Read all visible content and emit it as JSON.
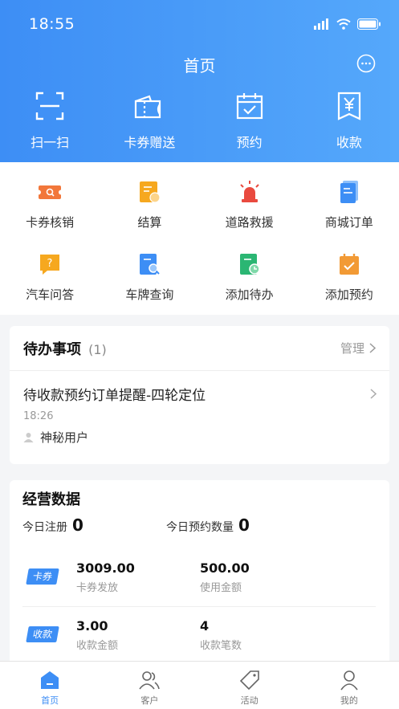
{
  "status_bar": {
    "time": "18:55"
  },
  "header": {
    "title": "首页",
    "actions": [
      {
        "label": "扫一扫",
        "icon": "scan-icon"
      },
      {
        "label": "卡券赠送",
        "icon": "coupon-gift-icon"
      },
      {
        "label": "预约",
        "icon": "calendar-check-icon"
      },
      {
        "label": "收款",
        "icon": "yen-receipt-icon"
      }
    ]
  },
  "grid": [
    {
      "label": "卡券核销",
      "icon": "coupon-verify-icon",
      "color": "#f2773a"
    },
    {
      "label": "结算",
      "icon": "settlement-icon",
      "color": "#f6a81f"
    },
    {
      "label": "道路救援",
      "icon": "siren-icon",
      "color": "#e94a3f"
    },
    {
      "label": "商城订单",
      "icon": "mall-order-icon",
      "color": "#3d8ef5"
    },
    {
      "label": "汽车问答",
      "icon": "qa-icon",
      "color": "#f6a81f"
    },
    {
      "label": "车牌查询",
      "icon": "plate-search-icon",
      "color": "#3d8ef5"
    },
    {
      "label": "添加待办",
      "icon": "add-todo-icon",
      "color": "#2bb673"
    },
    {
      "label": "添加预约",
      "icon": "add-appointment-icon",
      "color": "#f29a35"
    }
  ],
  "todo": {
    "title": "待办事项",
    "count": "(1)",
    "manage": "管理",
    "item": {
      "title": "待收款预约订单提醒-四轮定位",
      "time": "18:26",
      "user": "神秘用户"
    }
  },
  "business": {
    "title": "经营数据",
    "today_register_label": "今日注册",
    "today_register_value": "0",
    "today_booking_label": "今日预约数量",
    "today_booking_value": "0",
    "coupon": {
      "tag": "卡券",
      "issued_value": "3009.00",
      "issued_label": "卡券发放",
      "used_value": "500.00",
      "used_label": "使用金额"
    },
    "payment": {
      "tag": "收款",
      "amount_value": "3.00",
      "amount_label": "收款金额",
      "count_value": "4",
      "count_label": "收款笔数"
    }
  },
  "tabbar": [
    {
      "label": "首页",
      "icon": "home-icon",
      "active": true
    },
    {
      "label": "客户",
      "icon": "customers-icon",
      "active": false
    },
    {
      "label": "活动",
      "icon": "tag-icon",
      "active": false
    },
    {
      "label": "我的",
      "icon": "profile-icon",
      "active": false
    }
  ],
  "colors": {
    "primary": "#3d8ef5",
    "header_end": "#55a8fb"
  }
}
